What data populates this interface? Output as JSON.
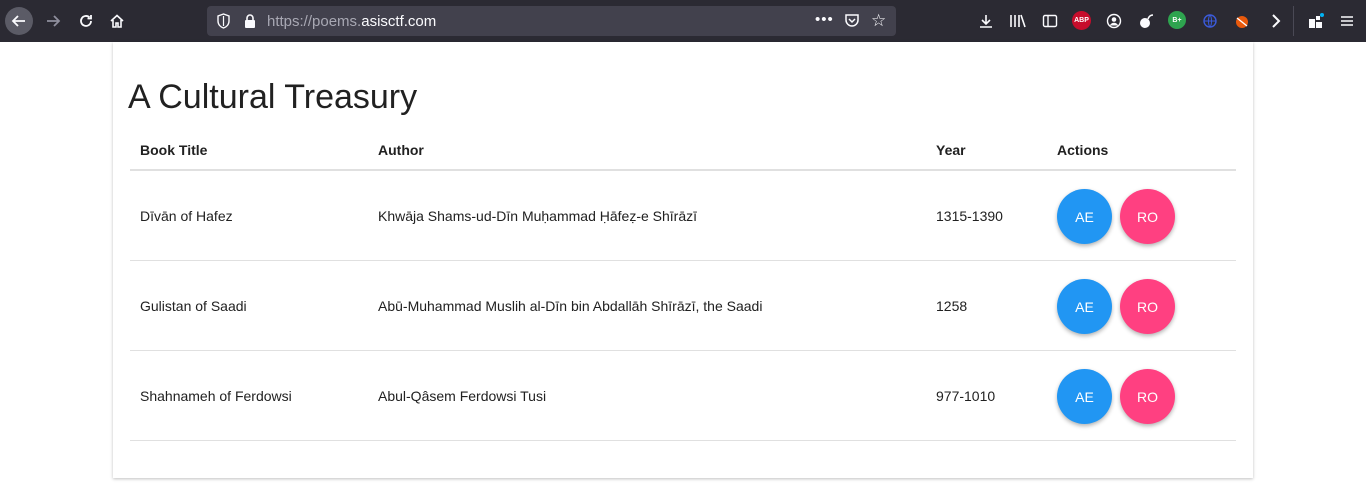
{
  "browser": {
    "url_scheme": "https://",
    "url_sub": "poems.",
    "url_domain": "asisctf.com",
    "icons": [
      "back-arrow-icon",
      "forward-arrow-icon",
      "reload-icon",
      "home-icon",
      "shield-icon",
      "lock-icon",
      "more-dots-icon",
      "pocket-icon",
      "bookmark-star-icon",
      "download-icon",
      "library-icon",
      "sidebar-icon",
      "adblock-icon",
      "account-icon",
      "extension-icon",
      "extension-icon",
      "extension-icon",
      "extension-icon",
      "chevron-right-icon",
      "extensions-icon",
      "menu-icon"
    ],
    "adblock_label": "ABP",
    "bplus_label": "B+"
  },
  "page": {
    "title": "A Cultural Treasury"
  },
  "table": {
    "headers": {
      "title": "Book Title",
      "author": "Author",
      "year": "Year",
      "actions": "Actions"
    },
    "rows": [
      {
        "title": "Dīvān of Hafez",
        "author": "Khwāja Shams-ud-Dīn Muḥammad Ḥāfeẓ-e Shīrāzī",
        "year": "1315-1390",
        "ae": "AE",
        "ro": "RO"
      },
      {
        "title": "Gulistan of Saadi",
        "author": "Abū-Muhammad Muslih al-Dīn bin Abdallāh Shīrāzī, the Saadi",
        "year": "1258",
        "ae": "AE",
        "ro": "RO"
      },
      {
        "title": "Shahnameh of Ferdowsi",
        "author": "Abul-Qâsem Ferdowsi Tusi",
        "year": "977-1010",
        "ae": "AE",
        "ro": "RO"
      }
    ]
  },
  "colors": {
    "ae_button": "#2196f3",
    "ro_button": "#ff4081",
    "toolbar": "#2b2a33"
  }
}
